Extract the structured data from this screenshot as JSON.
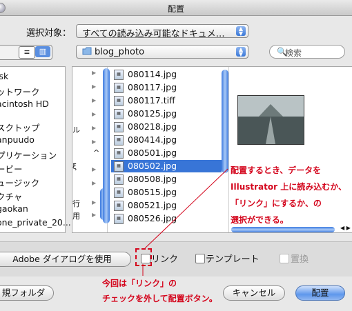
{
  "window": {
    "title": "配置"
  },
  "selection": {
    "label": "選択対象：",
    "value": "すべての読み込み可能なドキュメ…"
  },
  "view_buttons": [
    "≡",
    "▥"
  ],
  "location": {
    "folder": "blog_photo"
  },
  "search": {
    "placeholder": "検索"
  },
  "sidebar": {
    "items": [
      "isk",
      "ットワーク",
      "acintosh HD",
      "スクトップ",
      "anpuudo",
      "プリケーション",
      "ービー",
      "ュージック",
      "クチャ",
      "gaokan",
      "one_private_20..."
    ]
  },
  "column1": {
    "fragments": [
      "ル",
      "^",
      "ξ",
      "行",
      "用"
    ]
  },
  "files": {
    "items": [
      "080114.jpg",
      "080117.jpg",
      "080117.tiff",
      "080125.jpg",
      "080218.jpg",
      "080414.jpg",
      "080501.jpg",
      "080502.jpg",
      "080508.jpg",
      "080515.jpg",
      "080521.jpg",
      "080526.jpg"
    ],
    "selected": "080502.jpg"
  },
  "bottom": {
    "adobe_dialog_button": "Adobe ダイアログを使用",
    "link_label": "リンク",
    "template_label": "テンプレート",
    "replace_label": "置換",
    "new_folder_button": "規フォルダ",
    "cancel_button": "キャンセル",
    "place_button": "配置"
  },
  "annotations": {
    "preview_note": [
      "配置するとき、データを",
      "Illustrator 上に読み込むか、",
      "「リンク」にするか、の",
      "選択ができる。"
    ],
    "link_note": [
      "今回は「リンク」の",
      "チェックを外して配置ボタン。"
    ]
  },
  "colors": {
    "annotation": "#d4061d",
    "selection": "#3875d7",
    "default_button": "#5e97ec"
  }
}
